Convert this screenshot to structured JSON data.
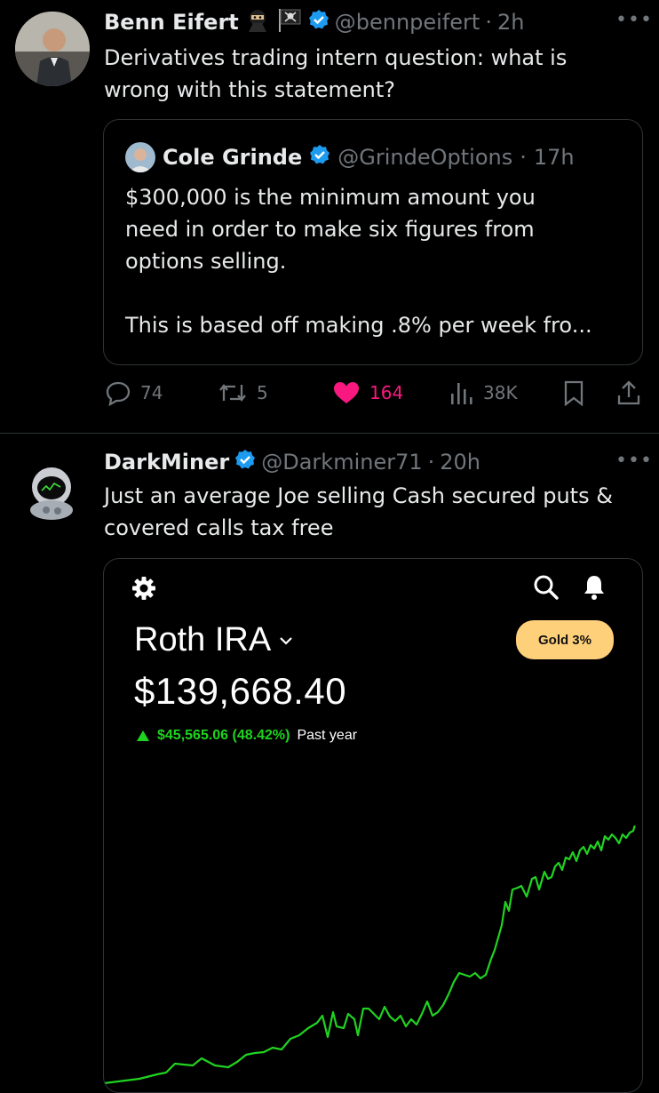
{
  "tweet1": {
    "name": "Benn Eifert",
    "handle": "@bennpeifert",
    "time": "2h",
    "text_line1": "Derivatives trading intern question: what is",
    "text_line2": "wrong with this statement?",
    "more_icon": "more-icon",
    "quote": {
      "name": "Cole Grinde",
      "handle": "@GrindeOptions",
      "time": "17h",
      "line1": "$300,000 is the minimum amount you",
      "line2": "need in order to make six figures from",
      "line3": "options selling.",
      "line4": "This is based off making .8% per week fro..."
    },
    "actions": {
      "replies": "74",
      "retweets": "5",
      "likes": "164",
      "views": "38K"
    },
    "like_color": "#f91880"
  },
  "tweet2": {
    "name": "DarkMiner",
    "handle": "@Darkminer71",
    "time": "20h",
    "text_line1": "Just an average Joe selling Cash secured puts &",
    "text_line2": "covered calls tax free",
    "embedded": {
      "account_title": "Roth IRA",
      "balance": "$139,668.40",
      "change": "$45,565.06 (48.42%)",
      "period": "Past year",
      "badge": "Gold 3%",
      "up_color": "#1fd41f"
    }
  },
  "verified_color": "#1d9bf0"
}
